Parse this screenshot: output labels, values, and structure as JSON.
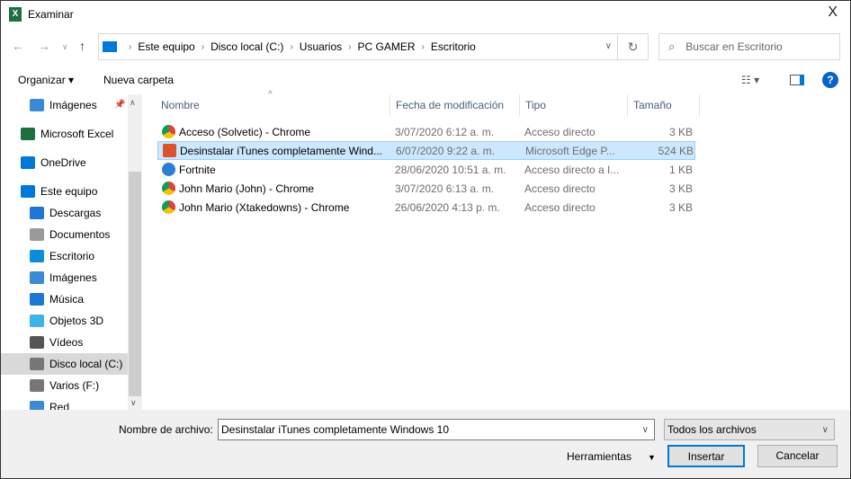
{
  "window": {
    "title": "Examinar",
    "app_icon": "excel-icon",
    "close": "X"
  },
  "address": {
    "crumbs": [
      "Este equipo",
      "Disco local (C:)",
      "Usuarios",
      "PC GAMER",
      "Escritorio"
    ]
  },
  "search": {
    "placeholder": "Buscar en Escritorio"
  },
  "toolbar": {
    "organize": "Organizar ▾",
    "new_folder": "Nueva carpeta"
  },
  "sidebar": {
    "items": [
      {
        "label": "Imágenes",
        "icon": "pictures-icon",
        "color": "#3a8ad6"
      },
      {
        "label": "Microsoft Excel",
        "icon": "excel-icon",
        "color": "#1d6f42"
      },
      {
        "label": "OneDrive",
        "icon": "cloud-icon",
        "color": "#0078d7"
      },
      {
        "label": "Este equipo",
        "icon": "computer-icon",
        "color": "#0078d7"
      },
      {
        "label": "Descargas",
        "icon": "download-icon",
        "color": "#1e77d3"
      },
      {
        "label": "Documentos",
        "icon": "documents-icon",
        "color": "#9a9a9a"
      },
      {
        "label": "Escritorio",
        "icon": "desktop-icon",
        "color": "#0a8ddb"
      },
      {
        "label": "Imágenes",
        "icon": "pictures-icon",
        "color": "#3a8ad6"
      },
      {
        "label": "Música",
        "icon": "music-icon",
        "color": "#1e77d3"
      },
      {
        "label": "Objetos 3D",
        "icon": "3d-objects-icon",
        "color": "#3cb4e6"
      },
      {
        "label": "Vídeos",
        "icon": "videos-icon",
        "color": "#555"
      },
      {
        "label": "Disco local (C:)",
        "icon": "drive-icon",
        "color": "#777",
        "selected": true
      },
      {
        "label": "Varios (F:)",
        "icon": "drive-icon",
        "color": "#777"
      },
      {
        "label": "Red",
        "icon": "network-icon",
        "color": "#3a8ad6"
      }
    ]
  },
  "columns": {
    "name": "Nombre",
    "date": "Fecha de modificación",
    "type": "Tipo",
    "size": "Tamaño"
  },
  "files": [
    {
      "name": "Acceso (Solvetic) - Chrome",
      "date": "3/07/2020 6:12 a. m.",
      "type": "Acceso directo",
      "size": "3 KB",
      "icon": "chrome-shortcut-icon"
    },
    {
      "name": "Desinstalar iTunes completamente Wind...",
      "date": "6/07/2020 9:22 a. m.",
      "type": "Microsoft Edge P...",
      "size": "524 KB",
      "icon": "pdf-icon",
      "selected": true
    },
    {
      "name": "Fortnite",
      "date": "28/06/2020 10:51 a. m.",
      "type": "Acceso directo a I...",
      "size": "1 KB",
      "icon": "fortnite-shortcut-icon"
    },
    {
      "name": "John Mario (John) - Chrome",
      "date": "3/07/2020 6:13 a. m.",
      "type": "Acceso directo",
      "size": "3 KB",
      "icon": "chrome-shortcut-icon"
    },
    {
      "name": "John Mario (Xtakedowns) - Chrome",
      "date": "26/06/2020 4:13 p. m.",
      "type": "Acceso directo",
      "size": "3 KB",
      "icon": "chrome-shortcut-icon"
    }
  ],
  "footer": {
    "filename_label": "Nombre de archivo:",
    "filename_value": "Desinstalar iTunes completamente Windows 10",
    "filter": "Todos los archivos",
    "tools": "Herramientas",
    "insert": "Insertar",
    "cancel": "Cancelar"
  }
}
